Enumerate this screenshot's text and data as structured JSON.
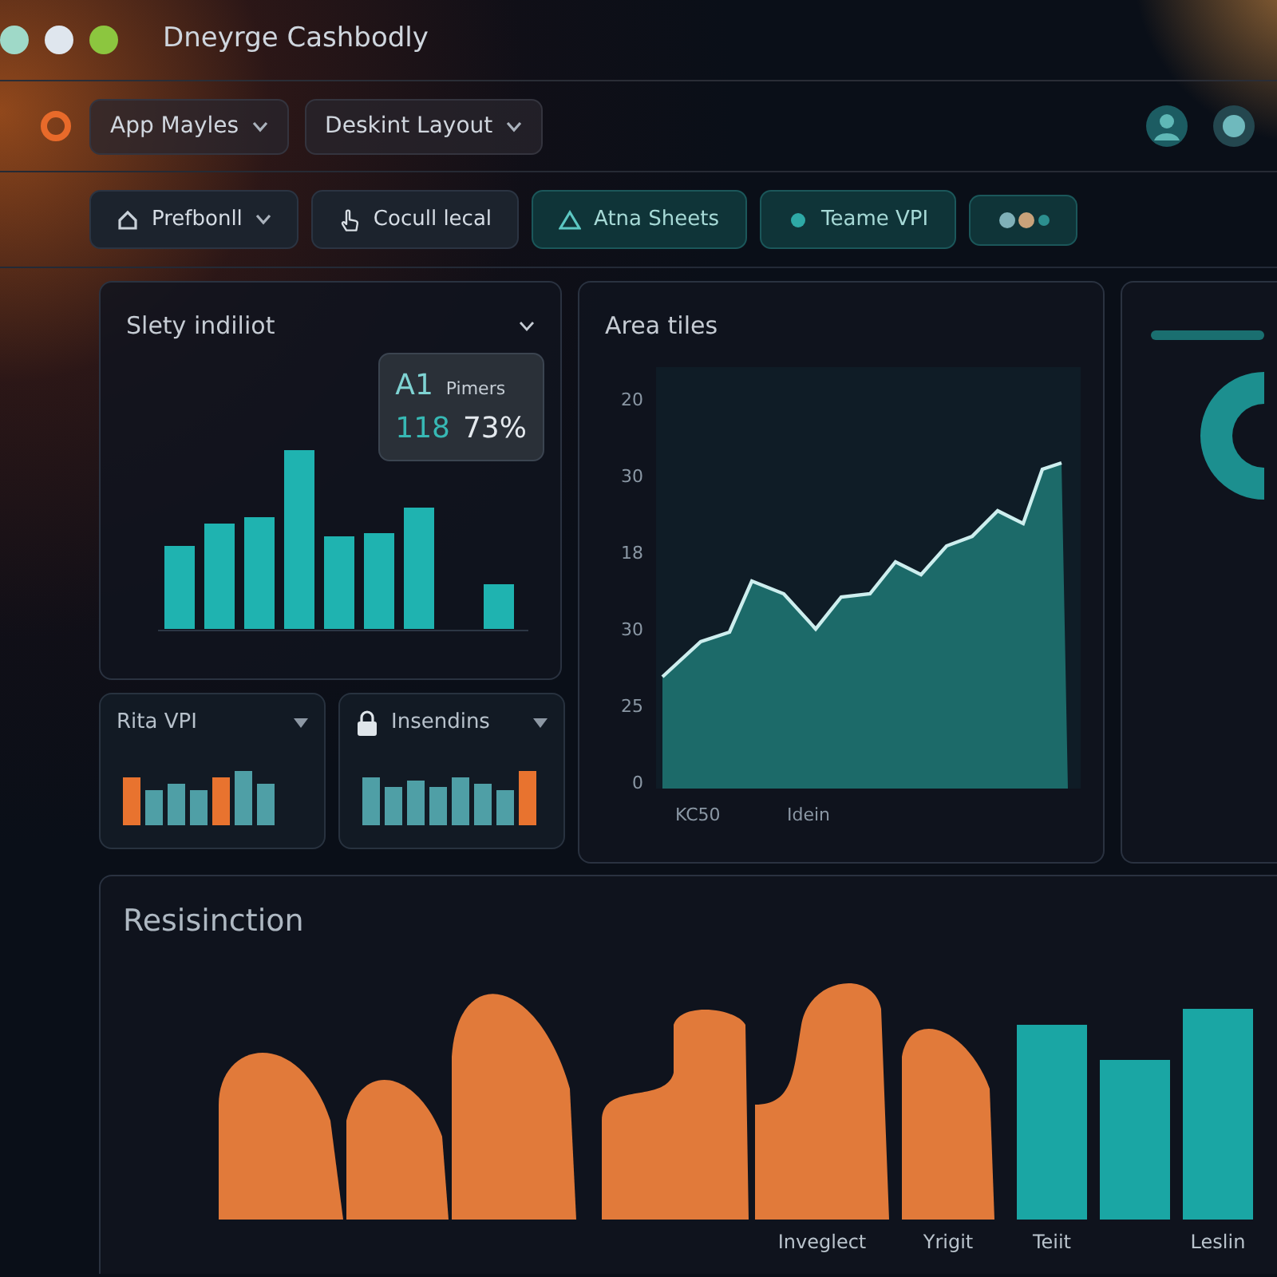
{
  "window": {
    "title": "Dneyrge Cashbodly"
  },
  "toolbar": {
    "menus": [
      {
        "label": "App Mayles"
      },
      {
        "label": "Deskint Layout"
      }
    ]
  },
  "actions": [
    {
      "label": "Prefbonll",
      "kind": "dropdown",
      "selected": false
    },
    {
      "label": "Cocull lecal",
      "kind": "button",
      "selected": false
    },
    {
      "label": "Atna Sheets",
      "kind": "button",
      "selected": true
    },
    {
      "label": "Teame VPI",
      "kind": "button",
      "selected": true
    }
  ],
  "bar_panel": {
    "title": "Slety indiliot",
    "tooltip": {
      "code": "A1",
      "caption": "Pimers",
      "count": "118",
      "percent": "73%"
    }
  },
  "area_panel": {
    "title": "Area tiles",
    "y_labels": [
      "20",
      "30",
      "18",
      "30",
      "25",
      "0"
    ],
    "x_labels": [
      "KC50",
      "Idein"
    ]
  },
  "mini_panels": [
    {
      "title": "Rita VPI",
      "locked": false
    },
    {
      "title": "Insendins",
      "locked": true
    }
  ],
  "bottom_panel": {
    "title": "Resisinction",
    "x_labels": [
      "Inveglect",
      "Yrigit",
      "Teiit",
      "Leslin"
    ]
  }
}
